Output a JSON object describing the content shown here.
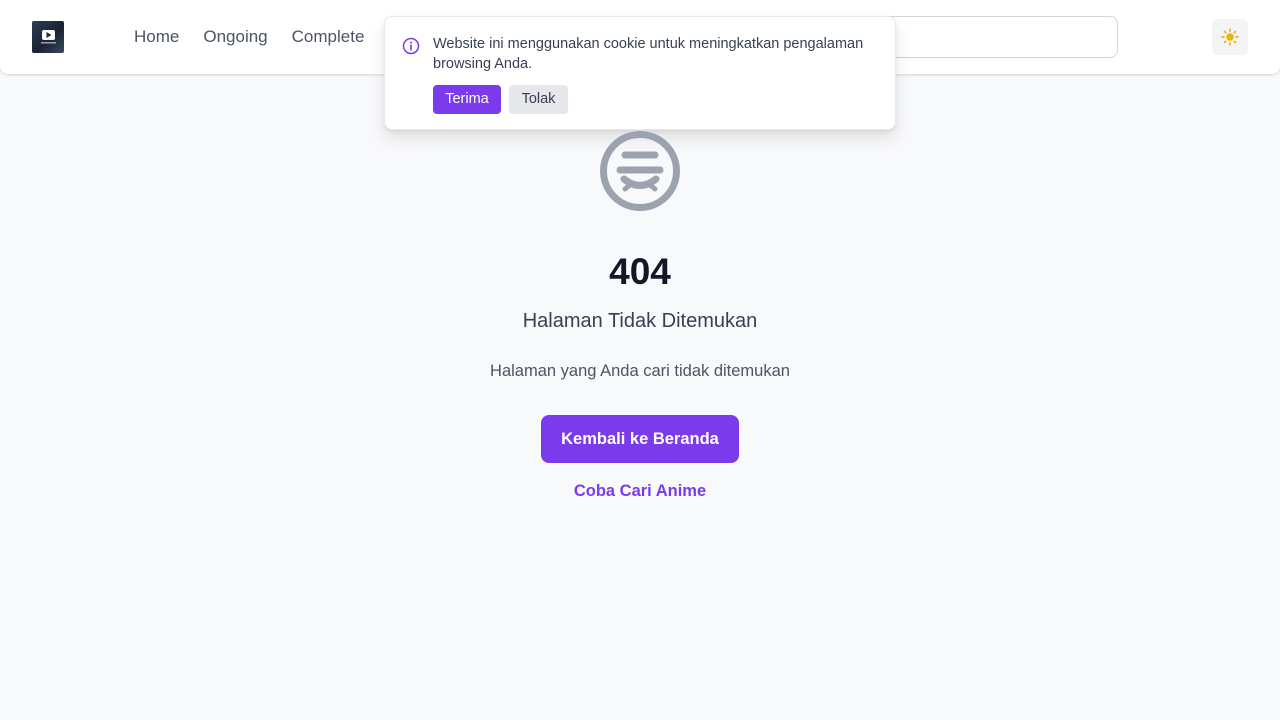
{
  "nav": {
    "items": [
      {
        "label": "Home"
      },
      {
        "label": "Ongoing"
      },
      {
        "label": "Complete"
      }
    ]
  },
  "search": {
    "placeholder": ""
  },
  "theme": {
    "icon": "sun-icon",
    "color": "#eab308"
  },
  "cookie": {
    "message": "Website ini menggunakan cookie untuk meningkatkan pengalaman browsing Anda.",
    "accept_label": "Terima",
    "reject_label": "Tolak",
    "icon": "info-icon"
  },
  "error": {
    "icon": "sad-face-icon",
    "code": "404",
    "title": "Halaman Tidak Ditemukan",
    "description": "Halaman yang Anda cari tidak ditemukan",
    "home_button": "Kembali ke Beranda",
    "search_link": "Coba Cari Anime"
  },
  "colors": {
    "accent": "#7c3aed",
    "background": "#f8f9fb",
    "icon_gray": "#9ca3af"
  }
}
